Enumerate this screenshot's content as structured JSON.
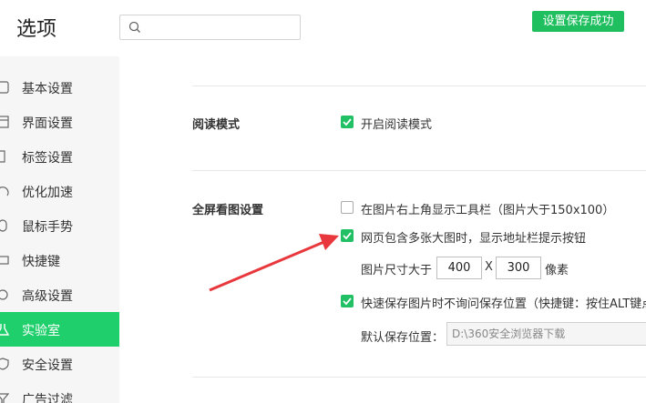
{
  "header": {
    "title": "选项",
    "search_placeholder": "",
    "save_status": "设置保存成功"
  },
  "sidebar": {
    "items": [
      {
        "label": "基本设置",
        "icon": "home-icon"
      },
      {
        "label": "界面设置",
        "icon": "layout-icon"
      },
      {
        "label": "标签设置",
        "icon": "tag-icon"
      },
      {
        "label": "优化加速",
        "icon": "speed-icon"
      },
      {
        "label": "鼠标手势",
        "icon": "mouse-icon"
      },
      {
        "label": "快捷键",
        "icon": "keyboard-icon"
      },
      {
        "label": "高级设置",
        "icon": "gear-icon"
      },
      {
        "label": "实验室",
        "icon": "flask-icon",
        "active": true
      },
      {
        "label": "安全设置",
        "icon": "shield-icon"
      },
      {
        "label": "广告过滤",
        "icon": "filter-icon"
      }
    ]
  },
  "reading_mode": {
    "title": "阅读模式",
    "enable_label": "开启阅读模式",
    "enabled": true
  },
  "fullscreen_image": {
    "title": "全屏看图设置",
    "show_toolbar_label": "在图片右上角显示工具栏（图片大于150x100）",
    "show_toolbar": false,
    "show_address_hint_label": "网页包含多张大图时，显示地址栏提示按钮",
    "show_address_hint": true,
    "size_prefix": "图片尺寸大于",
    "width": "400",
    "separator": "X",
    "height": "300",
    "unit": "像素",
    "quick_save_label": "快速保存图片时不询问保存位置（快捷键：按住ALT键点",
    "quick_save": true,
    "default_location_label": "默认保存位置：",
    "default_location": "D:\\360安全浏览器下载"
  },
  "colors": {
    "accent": "#1fcf6b",
    "checkbox": "#22c065",
    "annotation_arrow": "#e8383d"
  }
}
